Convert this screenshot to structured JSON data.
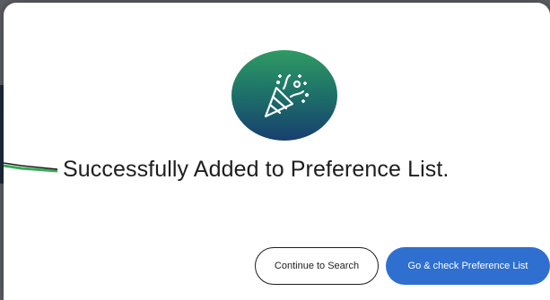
{
  "dialog": {
    "icon": "party-popper-icon",
    "message": "Successfully Added to Preference List.",
    "buttons": {
      "continue_label": "Continue to Search",
      "go_label": "Go & check Preference List"
    }
  },
  "colors": {
    "badge_top": "#2f9a63",
    "badge_bottom": "#173f6f",
    "primary_button": "#2f6fd0"
  }
}
